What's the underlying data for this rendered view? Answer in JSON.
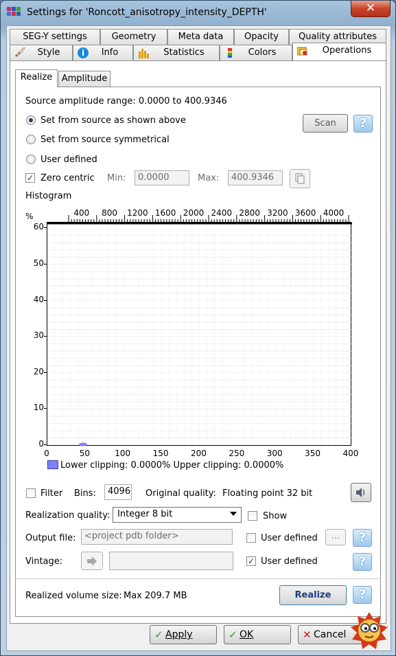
{
  "window": {
    "title": "Settings for 'Roncott_anisotropy_intensity_DEPTH'",
    "close_glyph": "✕"
  },
  "tabs_row1": [
    {
      "label": "SEG-Y settings"
    },
    {
      "label": "Geometry"
    },
    {
      "label": "Meta data"
    },
    {
      "label": "Opacity"
    },
    {
      "label": "Quality attributes"
    }
  ],
  "tabs_row2": [
    {
      "label": "Style",
      "icon": "brush-icon"
    },
    {
      "label": "Info",
      "icon": "info-icon"
    },
    {
      "label": "Statistics",
      "icon": "bar-chart-icon"
    },
    {
      "label": "Colors",
      "icon": "color-scale-icon"
    },
    {
      "label": "Operations",
      "icon": "operations-icon",
      "active": true
    }
  ],
  "subtabs": [
    {
      "label": "Realize",
      "active": true
    },
    {
      "label": "Amplitude"
    }
  ],
  "source_range": "Source amplitude range: 0.0000 to 400.9346",
  "scan_label": "Scan",
  "help_glyph": "?",
  "radio_options": [
    {
      "label": "Set from source as shown above",
      "selected": true
    },
    {
      "label": "Set from source symmetrical",
      "selected": false
    },
    {
      "label": "User defined",
      "selected": false
    }
  ],
  "zero_centric": {
    "label": "Zero centric",
    "checked": true,
    "check_glyph": "✓"
  },
  "min": {
    "label": "Min:",
    "value": "0.0000"
  },
  "max": {
    "label": "Max:",
    "value": "400.9346"
  },
  "histogram": {
    "label": "Histogram",
    "y_unit": "%",
    "y_ticks": [
      "0",
      "10",
      "20",
      "30",
      "40",
      "50",
      "60"
    ],
    "x_ticks": [
      "0",
      "50",
      "100",
      "150",
      "200",
      "250",
      "300",
      "350",
      "400"
    ],
    "top_ticks": [
      "400",
      "800",
      "1200",
      "1600",
      "2000",
      "2400",
      "2800",
      "3200",
      "3600",
      "4000"
    ],
    "legend": "Lower clipping: 0.0000% Upper clipping: 0.0000%",
    "colors": {
      "bar": "#8080ff",
      "grid": "#e6e6e6"
    }
  },
  "filter": {
    "label": "Filter",
    "checked": false
  },
  "bins": {
    "label": "Bins:",
    "value": "4096"
  },
  "original_quality": {
    "label": "Original quality:",
    "value": "Floating point 32 bit"
  },
  "realization_quality": {
    "label": "Realization quality:",
    "value": "Integer  8 bit"
  },
  "show": {
    "label": "Show",
    "checked": false
  },
  "output_file": {
    "label": "Output file:",
    "placeholder": "<project pdb folder>",
    "user_defined_label": "User defined",
    "user_defined_checked": false,
    "browse_label": "..."
  },
  "vintage": {
    "label": "Vintage:",
    "value": "",
    "user_defined_label": "User defined",
    "user_defined_checked": true
  },
  "realized_size": {
    "label": "Realized volume size:",
    "value": "Max 209.7 MB"
  },
  "realize_button": "Realize",
  "footer": {
    "apply": {
      "label": "Apply",
      "glyph": "✓"
    },
    "ok": {
      "label": "OK",
      "glyph": "✓"
    },
    "cancel": {
      "label": "Cancel",
      "glyph": "✕"
    }
  }
}
